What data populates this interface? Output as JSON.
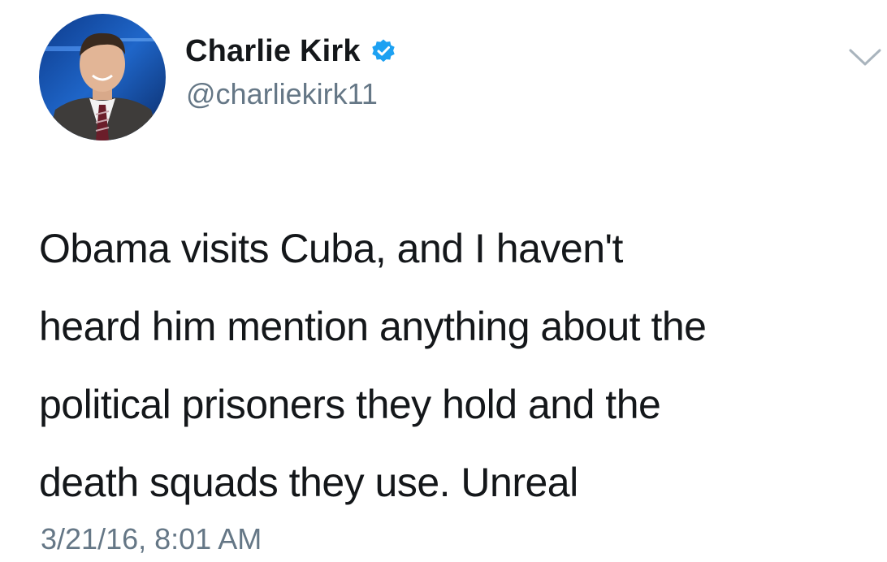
{
  "tweet": {
    "author": {
      "display_name": "Charlie Kirk",
      "handle": "@charliekirk11",
      "verified": true
    },
    "text_lines": [
      "Obama visits Cuba, and I haven't",
      "heard him mention anything about the",
      "political prisoners they hold and the",
      "death squads they use. Unreal"
    ],
    "timestamp": "3/21/16, 8:01 AM"
  },
  "icons": {
    "verified": "verified-badge-icon",
    "menu": "chevron-down-icon",
    "avatar": "profile-photo"
  },
  "colors": {
    "primary_text": "#14171a",
    "secondary_text": "#657786",
    "verified_blue": "#1da1f2",
    "background": "#ffffff"
  }
}
